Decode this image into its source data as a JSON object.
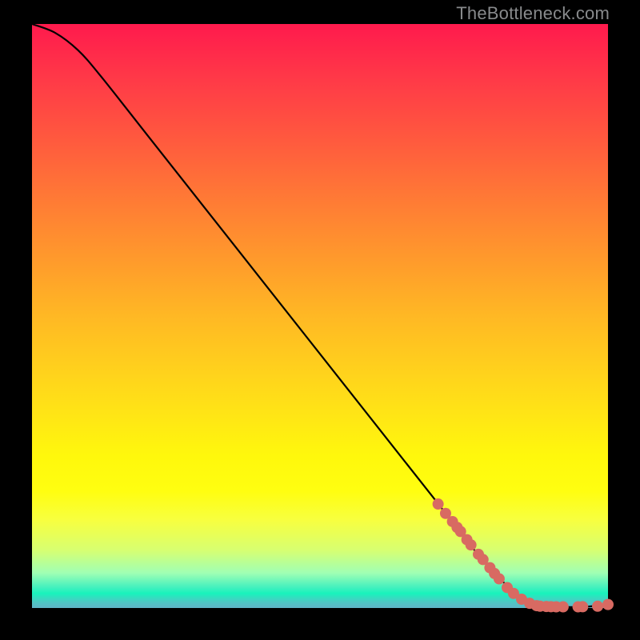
{
  "watermark": "TheBottleneck.com",
  "colors": {
    "curve": "#000000",
    "point_fill": "#d86a62",
    "point_stroke": "#9e4a44"
  },
  "chart_data": {
    "type": "line",
    "title": "",
    "xlabel": "",
    "ylabel": "",
    "xlim": [
      0,
      100
    ],
    "ylim": [
      0,
      100
    ],
    "grid": false,
    "series": [
      {
        "name": "curve",
        "x": [
          0,
          4,
          8,
          12,
          20,
          30,
          40,
          50,
          60,
          70,
          78,
          84,
          88,
          92,
          96,
          100
        ],
        "y": [
          100,
          98.5,
          95.5,
          91,
          81,
          68.5,
          56,
          43.5,
          31,
          18.5,
          8.5,
          2.5,
          0.5,
          0.2,
          0.2,
          0.6
        ]
      }
    ],
    "points": {
      "name": "highlighted",
      "x": [
        70.5,
        71.8,
        73.0,
        73.8,
        74.4,
        75.5,
        76.2,
        77.5,
        78.3,
        79.5,
        80.3,
        81.1,
        82.5,
        83.6,
        85.0,
        86.4,
        87.6,
        88.2,
        89.3,
        90.1,
        91.0,
        92.2,
        94.8,
        95.6,
        98.2,
        100
      ],
      "y": [
        17.8,
        16.2,
        14.8,
        13.8,
        13.1,
        11.7,
        10.8,
        9.2,
        8.3,
        6.9,
        5.9,
        5.0,
        3.5,
        2.5,
        1.5,
        0.8,
        0.4,
        0.3,
        0.25,
        0.22,
        0.2,
        0.2,
        0.2,
        0.22,
        0.3,
        0.6
      ]
    }
  }
}
